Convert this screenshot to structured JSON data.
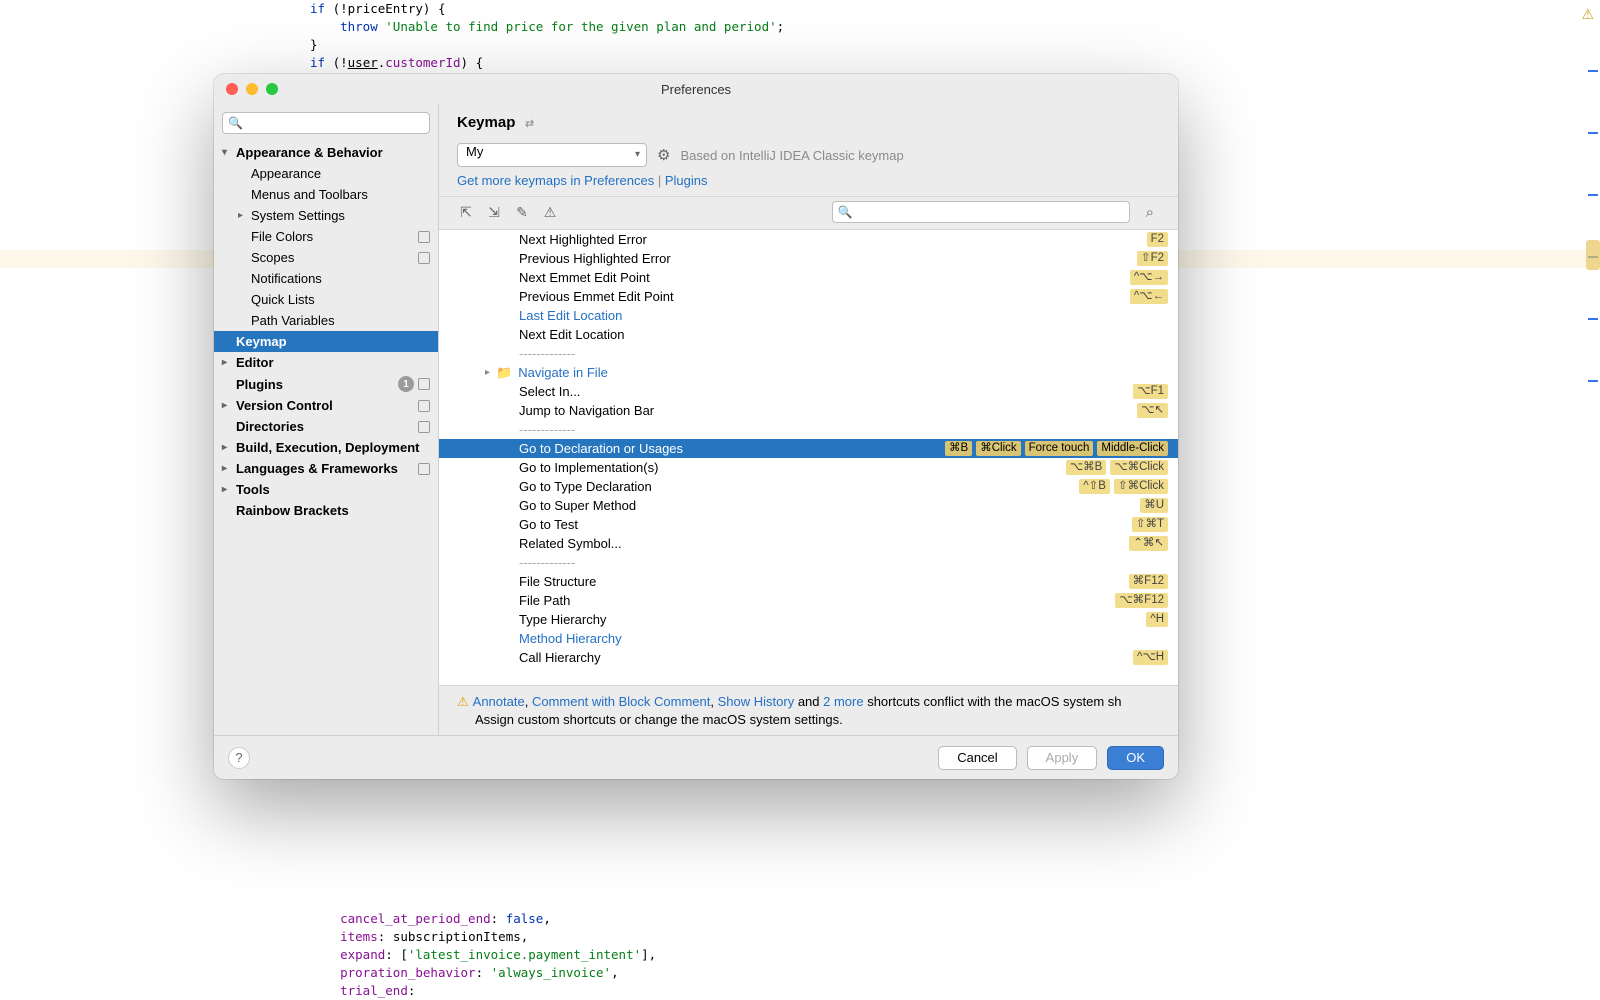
{
  "editor": {
    "top_code_lines": [
      [
        [
          "kw",
          "if"
        ],
        [
          "",
          " (!"
        ],
        [
          "ident",
          "priceEntry"
        ],
        [
          "",
          ") {"
        ]
      ],
      [
        [
          "",
          "    "
        ],
        [
          "kw",
          "throw"
        ],
        [
          "",
          " "
        ],
        [
          "str",
          "'Unable to find price for the given plan and period'"
        ],
        [
          "",
          ";"
        ]
      ],
      [
        [
          "",
          "}"
        ]
      ],
      [
        [
          "kw",
          "if"
        ],
        [
          "",
          " (!"
        ],
        [
          "u",
          "user"
        ],
        [
          "",
          "."
        ],
        [
          "prop",
          "customerId"
        ],
        [
          "",
          ") {"
        ]
      ]
    ],
    "bottom_code_lines": [
      [
        [
          "",
          "    "
        ],
        [
          "prop",
          "cancel_at_period_end"
        ],
        [
          "",
          ": "
        ],
        [
          "kw",
          "false"
        ],
        [
          "",
          ","
        ]
      ],
      [
        [
          "",
          "    "
        ],
        [
          "prop",
          "items"
        ],
        [
          "",
          ": "
        ],
        [
          "ident",
          "subscriptionItems"
        ],
        [
          "",
          ","
        ]
      ],
      [
        [
          "",
          "    "
        ],
        [
          "prop",
          "expand"
        ],
        [
          "",
          ": ["
        ],
        [
          "str",
          "'latest_invoice.payment_intent'"
        ],
        [
          "",
          "],"
        ]
      ],
      [
        [
          "",
          "    "
        ],
        [
          "prop",
          "proration_behavior"
        ],
        [
          "",
          ": "
        ],
        [
          "str",
          "'always_invoice'"
        ],
        [
          "",
          ","
        ]
      ],
      [
        [
          "",
          "    "
        ],
        [
          "prop",
          "trial_end"
        ],
        [
          "",
          ":"
        ]
      ]
    ]
  },
  "dialog": {
    "title": "Preferences",
    "sidebar_search_placeholder": "",
    "sidebar": [
      {
        "label": "Appearance & Behavior",
        "lvl": 0,
        "bold": true,
        "chev": "v"
      },
      {
        "label": "Appearance",
        "lvl": 1
      },
      {
        "label": "Menus and Toolbars",
        "lvl": 1
      },
      {
        "label": "System Settings",
        "lvl": 1,
        "chev": ">"
      },
      {
        "label": "File Colors",
        "lvl": 1,
        "proj": true
      },
      {
        "label": "Scopes",
        "lvl": 1,
        "proj": true
      },
      {
        "label": "Notifications",
        "lvl": 1
      },
      {
        "label": "Quick Lists",
        "lvl": 1
      },
      {
        "label": "Path Variables",
        "lvl": 1
      },
      {
        "label": "Keymap",
        "lvl": 0,
        "bold": true,
        "selected": true
      },
      {
        "label": "Editor",
        "lvl": 0,
        "bold": true,
        "chev": ">"
      },
      {
        "label": "Plugins",
        "lvl": 0,
        "bold": true,
        "badge": "1",
        "proj": true
      },
      {
        "label": "Version Control",
        "lvl": 0,
        "bold": true,
        "chev": ">",
        "proj": true
      },
      {
        "label": "Directories",
        "lvl": 0,
        "bold": true,
        "proj": true
      },
      {
        "label": "Build, Execution, Deployment",
        "lvl": 0,
        "bold": true,
        "chev": ">"
      },
      {
        "label": "Languages & Frameworks",
        "lvl": 0,
        "bold": true,
        "chev": ">",
        "proj": true
      },
      {
        "label": "Tools",
        "lvl": 0,
        "bold": true,
        "chev": ">"
      },
      {
        "label": "Rainbow Brackets",
        "lvl": 0,
        "bold": true
      }
    ],
    "main_title": "Keymap",
    "keymap_name": "My",
    "based_on": "Based on IntelliJ IDEA Classic keymap",
    "get_more_1": "Get more keymaps in Preferences",
    "get_more_sep": " | ",
    "get_more_2": "Plugins",
    "actions": [
      {
        "label": "Next Highlighted Error",
        "sc": [
          "F2"
        ]
      },
      {
        "label": "Previous Highlighted Error",
        "sc": [
          "⇧F2"
        ]
      },
      {
        "label": "Next Emmet Edit Point",
        "sc": [
          "^⌥→"
        ]
      },
      {
        "label": "Previous Emmet Edit Point",
        "sc": [
          "^⌥←"
        ]
      },
      {
        "label": "Last Edit Location",
        "link": true
      },
      {
        "label": "Next Edit Location"
      },
      {
        "label": "-------------",
        "sep": true
      },
      {
        "label": "Navigate in File",
        "link": true,
        "folder": true
      },
      {
        "label": "Select In...",
        "sc": [
          "⌥F1"
        ]
      },
      {
        "label": "Jump to Navigation Bar",
        "sc": [
          "⌥↖"
        ]
      },
      {
        "label": "-------------",
        "sep": true
      },
      {
        "label": "Go to Declaration or Usages",
        "selected": true,
        "sc": [
          "⌘B",
          "⌘Click",
          "Force touch",
          "Middle-Click"
        ]
      },
      {
        "label": "Go to Implementation(s)",
        "sc": [
          "⌥⌘B",
          "⌥⌘Click"
        ]
      },
      {
        "label": "Go to Type Declaration",
        "sc": [
          "^⇧B",
          "⇧⌘Click"
        ]
      },
      {
        "label": "Go to Super Method",
        "sc": [
          "⌘U"
        ]
      },
      {
        "label": "Go to Test",
        "sc": [
          "⇧⌘T"
        ]
      },
      {
        "label": "Related Symbol...",
        "sc": [
          "⌃⌘↖"
        ]
      },
      {
        "label": "-------------",
        "sep": true
      },
      {
        "label": "File Structure",
        "sc": [
          "⌘F12"
        ]
      },
      {
        "label": "File Path",
        "sc": [
          "⌥⌘F12"
        ]
      },
      {
        "label": "Type Hierarchy",
        "sc": [
          "^H"
        ]
      },
      {
        "label": "Method Hierarchy",
        "link": true
      },
      {
        "label": "Call Hierarchy",
        "sc": [
          "^⌥H"
        ]
      }
    ],
    "conflict": {
      "links": [
        "Annotate",
        "Comment with Block Comment",
        "Show History"
      ],
      "and": " and ",
      "more": "2 more",
      "tail": " shortcuts conflict with the macOS system sh",
      "line2": "Assign custom shortcuts or change the macOS system settings."
    },
    "buttons": {
      "cancel": "Cancel",
      "apply": "Apply",
      "ok": "OK"
    }
  }
}
